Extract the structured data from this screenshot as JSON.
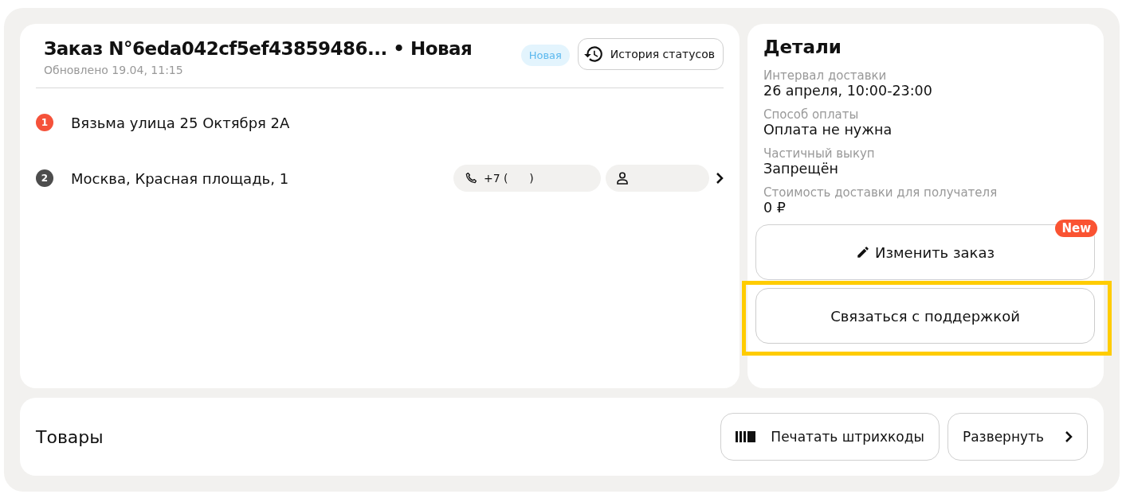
{
  "order": {
    "title": "Заказ N°6eda042cf5ef43859486... • Новая",
    "status_badge": "Новая",
    "history_button": "История статусов",
    "updated": "Обновлено 19.04, 11:15"
  },
  "route": [
    {
      "number": "1",
      "color": "#f5523a",
      "address": "Вязьма улица 25 Октября 2А",
      "has_contacts": false
    },
    {
      "number": "2",
      "color": "#4d4d4d",
      "address": "Москва, Красная площадь, 1",
      "has_contacts": true,
      "phone": "+7 (      )"
    }
  ],
  "details": {
    "title": "Детали",
    "fields": [
      {
        "label": "Интервал доставки",
        "value": "26 апреля, 10:00-23:00"
      },
      {
        "label": "Способ оплаты",
        "value": "Оплата не нужна"
      },
      {
        "label": "Частичный выкуп",
        "value": "Запрещён"
      },
      {
        "label": "Стоимость доставки для получателя",
        "value": "0 ₽"
      }
    ],
    "buttons": [
      {
        "kind": "edit",
        "label": "Изменить заказ",
        "badge": "New"
      },
      {
        "kind": "plain",
        "label": "Связаться с поддержкой",
        "highlighted": true
      }
    ]
  },
  "goods": {
    "title": "Товары",
    "print_button": "Печатать штрихкоды",
    "expand_button": "Развернуть"
  }
}
